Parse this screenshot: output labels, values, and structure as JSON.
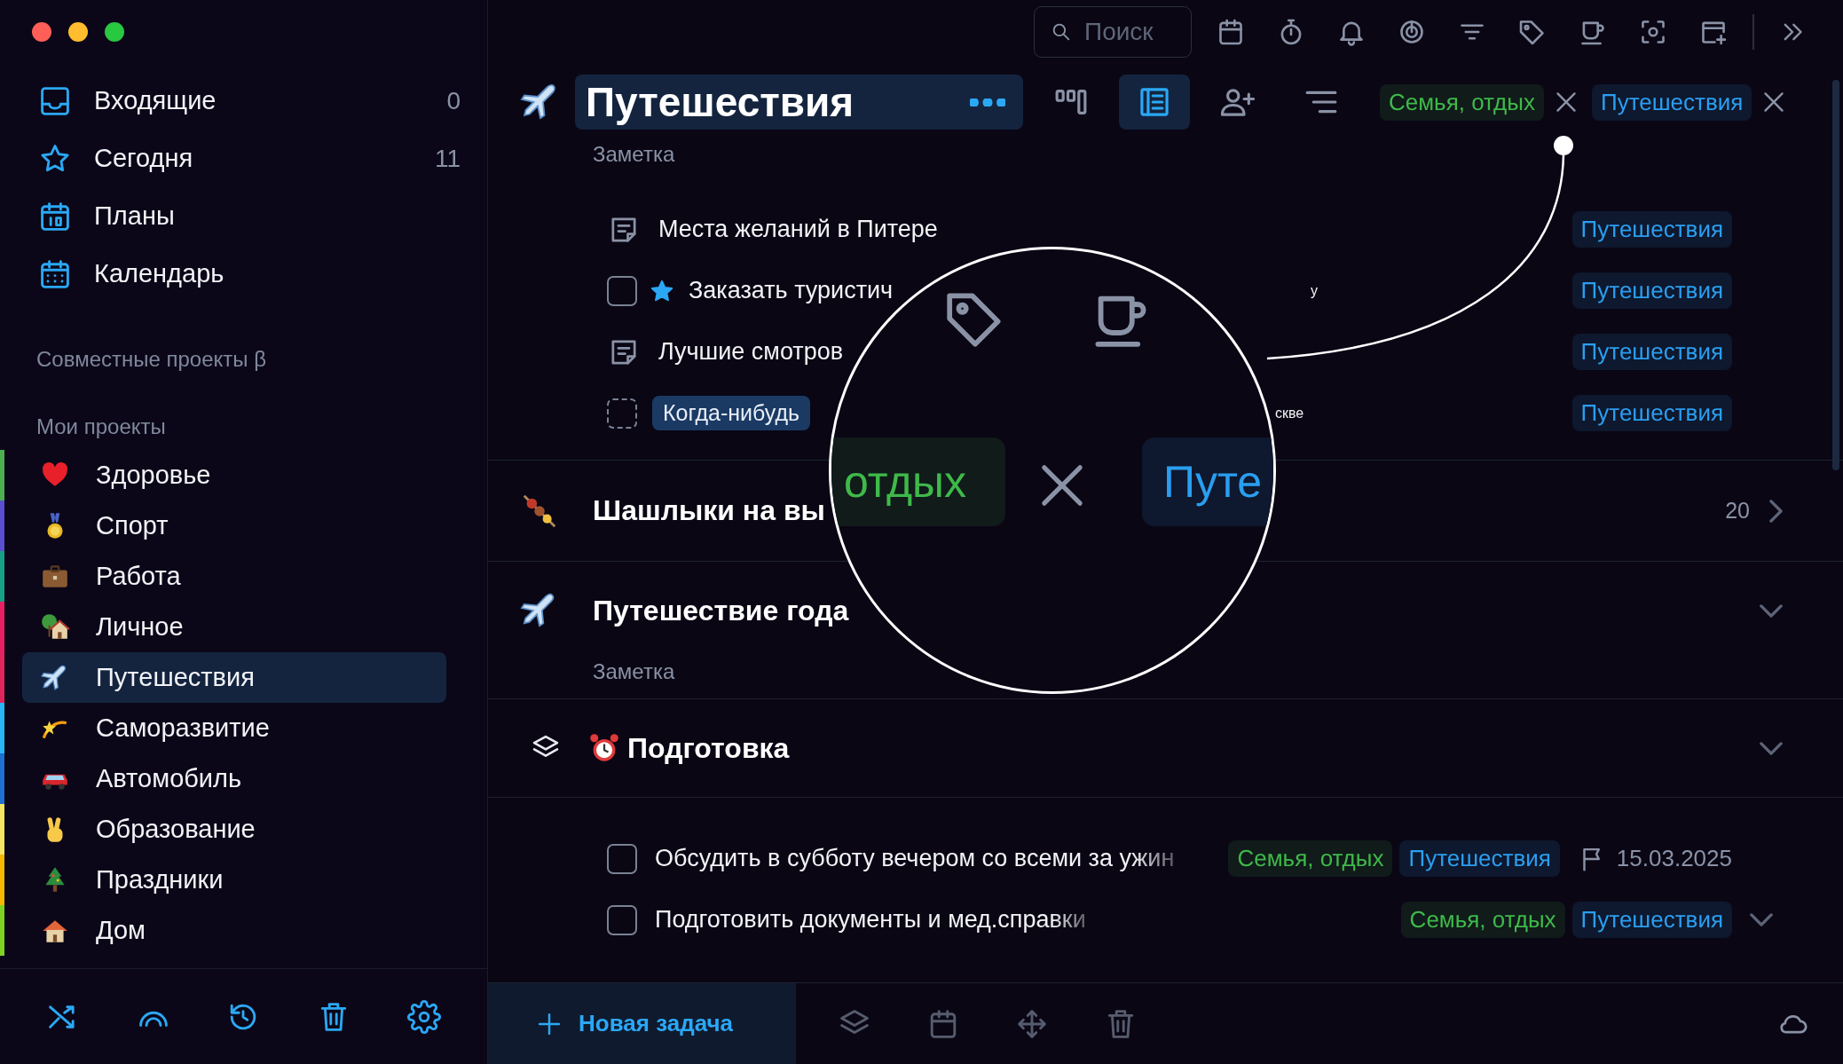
{
  "window_buttons": [
    {
      "color": "#ff5f57"
    },
    {
      "color": "#febc2e"
    },
    {
      "color": "#28c840"
    }
  ],
  "sidebar": {
    "nav_items": [
      {
        "label": "Входящие",
        "count": "0",
        "selected": false
      },
      {
        "label": "Сегодня",
        "count": "11",
        "selected": false
      },
      {
        "label": "Планы",
        "selected": false
      },
      {
        "label": "Календарь",
        "selected": false
      }
    ],
    "shared_heading": "Совместные проекты β",
    "projects_heading": "Мои проекты",
    "projects": [
      {
        "label": "Здоровье",
        "color": "#4caf50",
        "selected": false
      },
      {
        "label": "Спорт",
        "color": "#5a4fcf",
        "selected": false
      },
      {
        "label": "Работа",
        "color": "#16a085",
        "selected": false
      },
      {
        "label": "Личное",
        "color": "#e91e63",
        "selected": false
      },
      {
        "label": "Путешествия",
        "color": "#e0245e",
        "selected": true
      },
      {
        "label": "Саморазвитие",
        "color": "#29b6f6",
        "selected": false
      },
      {
        "label": "Автомобиль",
        "color": "#1e6fd0",
        "selected": false
      },
      {
        "label": "Образование",
        "color": "#f5e663",
        "selected": false
      },
      {
        "label": "Праздники",
        "color": "#f5b700",
        "selected": false
      },
      {
        "label": "Дом",
        "color": "#7ed321",
        "selected": false
      }
    ]
  },
  "toolbar": {
    "search": {
      "placeholder": "Поиск"
    }
  },
  "project": {
    "title": "Путешествия",
    "views": [
      {
        "selected": false
      },
      {
        "selected": true
      }
    ],
    "filters": [
      {
        "label": "Семья, отдых",
        "color": "#3fb94a"
      },
      {
        "label": "Путешествия",
        "color": "#2a9ef0"
      }
    ],
    "note": "Заметка",
    "tasks": [
      {
        "kind": "note",
        "title": "Места желаний в Питере",
        "tags": [
          {
            "label": "Путешествия",
            "color": "#2a9ef0"
          }
        ]
      },
      {
        "kind": "task",
        "checked": false,
        "starred": true,
        "title": "Заказать туристич",
        "tail": "у",
        "tags": [
          {
            "label": "Путешествия",
            "color": "#2a9ef0"
          }
        ]
      },
      {
        "kind": "note",
        "title": "Лучшие смотров",
        "tags": [
          {
            "label": "Путешествия",
            "color": "#2a9ef0"
          }
        ]
      },
      {
        "kind": "someday",
        "checked": false,
        "badge": "Когда-нибудь",
        "tail": "скве",
        "tags": [
          {
            "label": "Путешествия",
            "color": "#2a9ef0"
          }
        ]
      }
    ]
  },
  "subprojects": [
    {
      "title": "Шашлыки на вы",
      "count": "20",
      "expanded": false
    },
    {
      "title": "Путешествие года",
      "expanded": true,
      "note": "Заметка"
    }
  ],
  "heading": {
    "title": "Подготовка",
    "expanded": true,
    "tasks": [
      {
        "title": "Обсудить в субботу вечером со всеми за ужин",
        "checked": false,
        "expandable": false,
        "tags": [
          {
            "label": "Семья, отдых",
            "color": "#3fb94a"
          },
          {
            "label": "Путешествия",
            "color": "#2a9ef0"
          }
        ],
        "date": "15.03.2025"
      },
      {
        "title": "Подготовить документы и мед.справки",
        "checked": false,
        "expandable": true,
        "tags": [
          {
            "label": "Семья, отдых",
            "color": "#3fb94a"
          },
          {
            "label": "Путешествия",
            "color": "#2a9ef0"
          }
        ]
      }
    ]
  },
  "magnifier": {
    "tags": [
      {
        "label": "отдых",
        "color": "#3fb94a"
      },
      {
        "label": "Путе",
        "color": "#2a9ef0"
      }
    ]
  },
  "footer": {
    "new_task": "Новая задача"
  }
}
